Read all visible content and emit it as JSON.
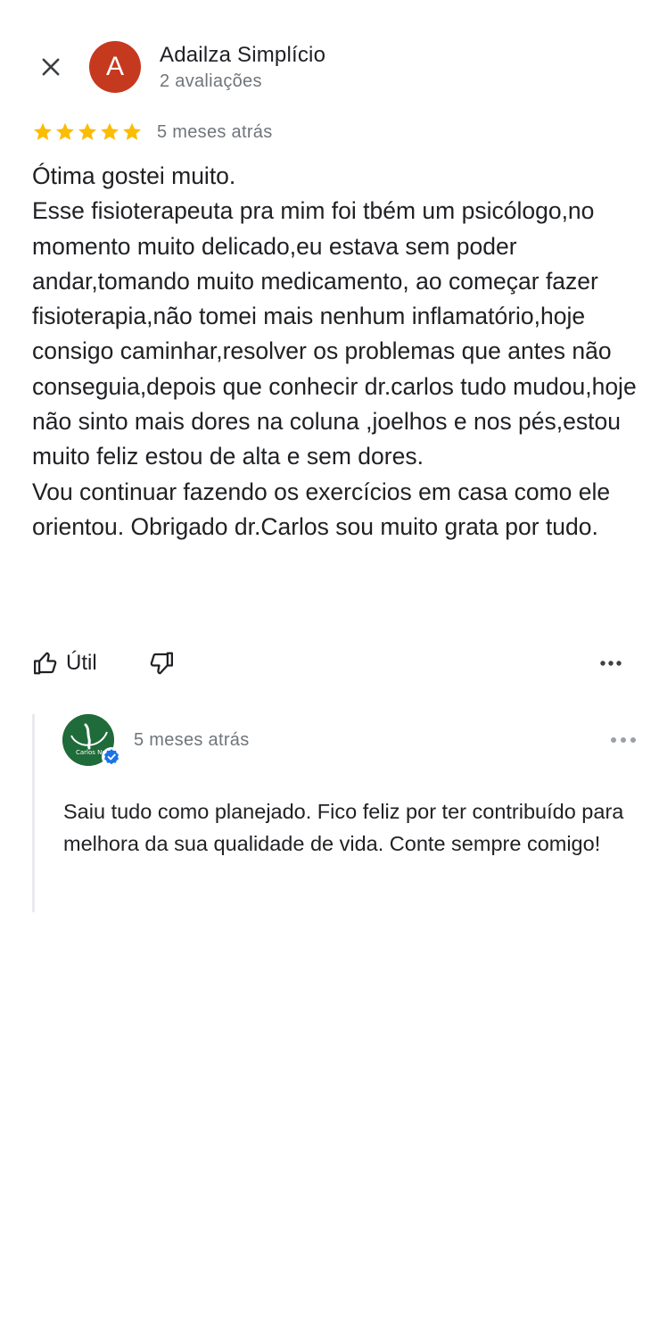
{
  "review": {
    "close_icon": "close-icon",
    "author": {
      "initial": "A",
      "name": "Adailza Simplício",
      "reviews_count": "2 avaliações",
      "avatar_color": "#c5391e"
    },
    "rating": 5,
    "rating_max": 5,
    "date": "5 meses atrás",
    "text": "Ótima gostei muito.\nEsse fisioterapeuta pra mim foi tbém um psicólogo,no momento muito delicado,eu estava sem poder andar,tomando muito medicamento, ao começar fazer fisioterapia,não tomei mais nenhum inflamatório,hoje consigo caminhar,resolver os problemas que antes não conseguia,depois que conhecir dr.carlos tudo mudou,hoje não sinto mais dores na coluna ,joelhos e nos pés,estou muito feliz estou de alta e sem dores.\nVou continuar fazendo os exercícios em casa como ele orientou. Obrigado dr.Carlos sou muito grata por tudo.",
    "actions": {
      "helpful_label": "Útil",
      "helpful_icon": "thumbs-up-icon",
      "not_helpful_icon": "thumbs-down-icon",
      "more_icon": "more-horizontal-icon"
    }
  },
  "reply": {
    "avatar_logo_text": "Carlos Nob",
    "avatar_color": "#1f6b3a",
    "verified_icon": "verified-badge-icon",
    "date": "5 meses atrás",
    "more_icon": "more-horizontal-icon",
    "text": "Saiu tudo como planejado. Fico feliz por ter contribuído para melhora da sua qualidade de vida. Conte sempre comigo!"
  },
  "colors": {
    "star": "#fbbc04",
    "secondary_text": "#70757a",
    "primary_text": "#202124",
    "verified": "#1a73e8"
  }
}
